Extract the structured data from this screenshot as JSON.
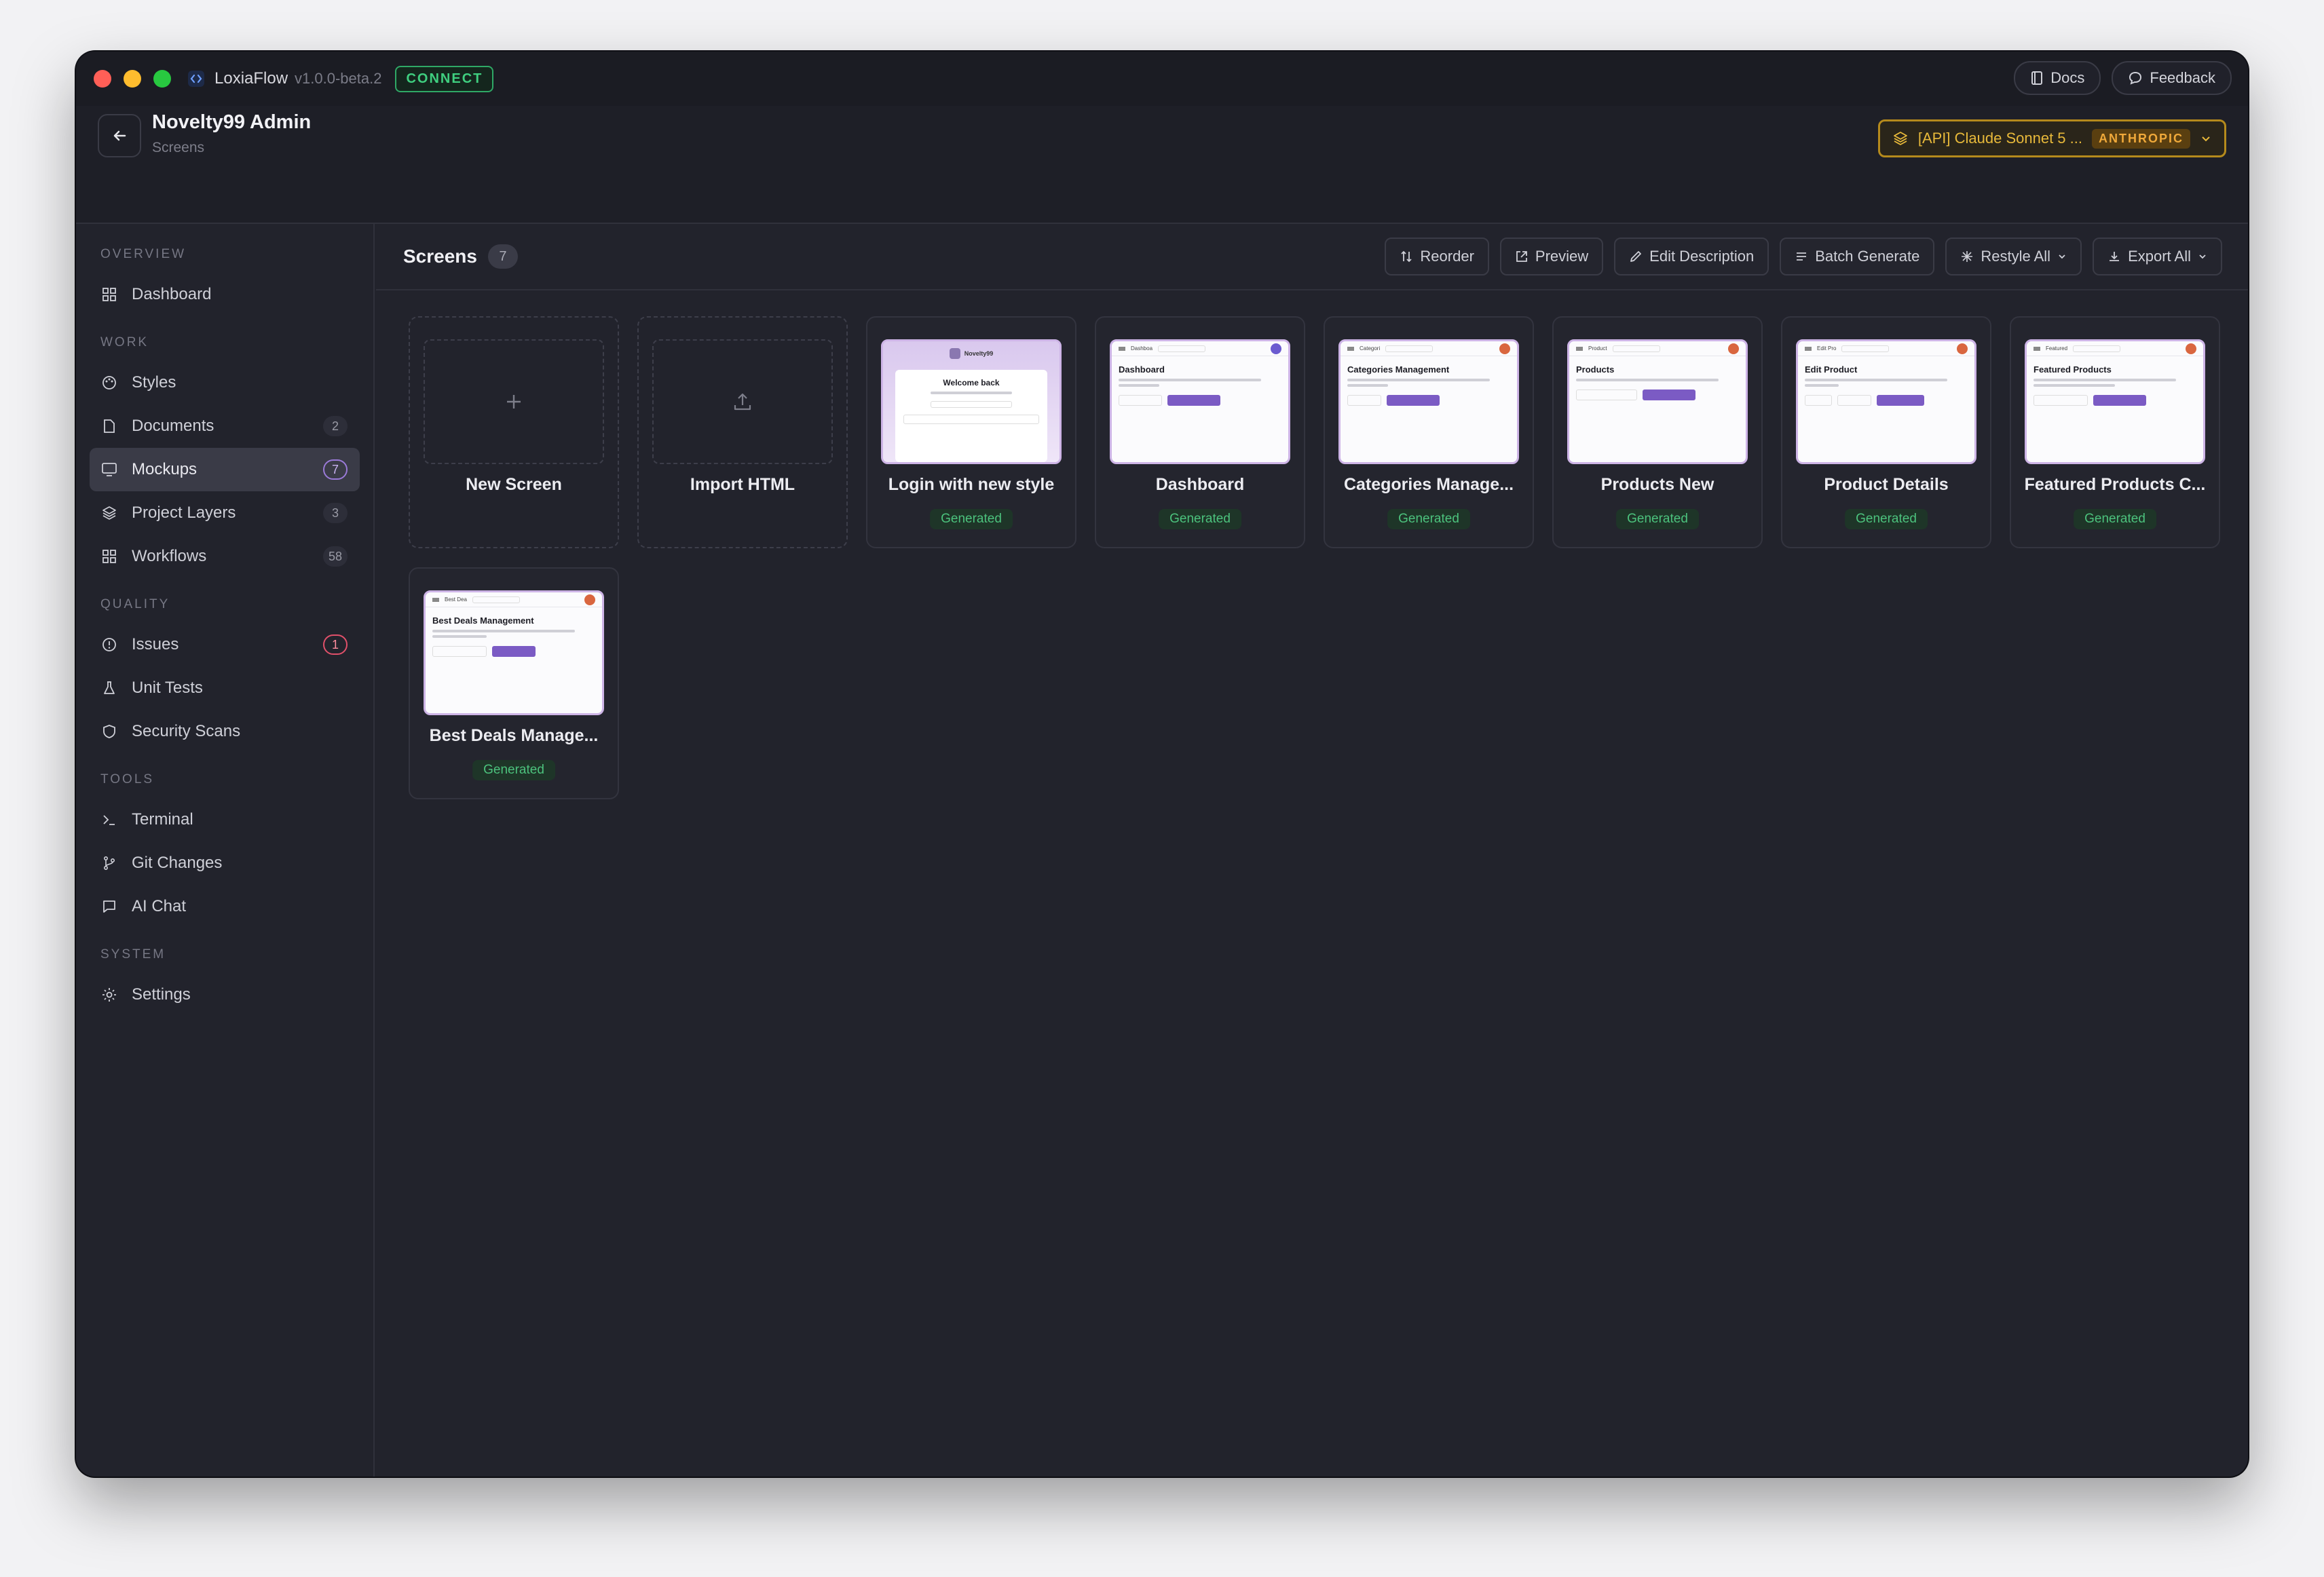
{
  "app": {
    "name": "LoxiaFlow",
    "version": "v1.0.0-beta.2",
    "connect_label": "CONNECT"
  },
  "titlebar": {
    "docs_label": "Docs",
    "feedback_label": "Feedback"
  },
  "project": {
    "name": "Novelty99 Admin",
    "subtitle": "Screens"
  },
  "model": {
    "label": "[API] Claude Sonnet 5 ...",
    "provider": "ANTHROPIC"
  },
  "sidebar": {
    "sections": [
      {
        "title": "OVERVIEW",
        "items": [
          {
            "label": "Dashboard",
            "icon": "grid-icon"
          }
        ]
      },
      {
        "title": "WORK",
        "items": [
          {
            "label": "Styles",
            "icon": "palette-icon"
          },
          {
            "label": "Documents",
            "icon": "document-icon",
            "badge": "2"
          },
          {
            "label": "Mockups",
            "icon": "monitor-icon",
            "badge": "7",
            "active": true
          },
          {
            "label": "Project Layers",
            "icon": "layers-icon",
            "badge": "3"
          },
          {
            "label": "Workflows",
            "icon": "grid-icon",
            "badge": "58"
          }
        ]
      },
      {
        "title": "QUALITY",
        "items": [
          {
            "label": "Issues",
            "icon": "alert-circle-icon",
            "badge": "1"
          },
          {
            "label": "Unit Tests",
            "icon": "flask-icon"
          },
          {
            "label": "Security Scans",
            "icon": "shield-icon"
          }
        ]
      },
      {
        "title": "TOOLS",
        "items": [
          {
            "label": "Terminal",
            "icon": "terminal-icon"
          },
          {
            "label": "Git Changes",
            "icon": "git-branch-icon"
          },
          {
            "label": "AI Chat",
            "icon": "chat-icon"
          }
        ]
      },
      {
        "title": "SYSTEM",
        "items": [
          {
            "label": "Settings",
            "icon": "gear-icon"
          }
        ]
      }
    ]
  },
  "toolbar": {
    "title": "Screens",
    "count": "7",
    "reorder": "Reorder",
    "preview": "Preview",
    "edit_description": "Edit Description",
    "batch_generate": "Batch Generate",
    "restyle_all": "Restyle All",
    "export_all": "Export All"
  },
  "cards": {
    "new_screen": "New Screen",
    "import_html": "Import HTML",
    "screens": [
      {
        "label": "Login with new style",
        "status": "Generated",
        "thumb_title": "Welcome back",
        "thumb_brand": "Novelty99"
      },
      {
        "label": "Dashboard",
        "status": "Generated",
        "thumb_title": "Dashboard",
        "thumb_tab": "Dashboa"
      },
      {
        "label": "Categories Manage...",
        "status": "Generated",
        "thumb_title": "Categories Management",
        "thumb_tab": "Categori"
      },
      {
        "label": "Products New",
        "status": "Generated",
        "thumb_title": "Products",
        "thumb_tab": "Product"
      },
      {
        "label": "Product Details",
        "status": "Generated",
        "thumb_title": "Edit Product",
        "thumb_tab": "Edit Pro"
      },
      {
        "label": "Featured Products C...",
        "status": "Generated",
        "thumb_title": "Featured Products",
        "thumb_tab": "Featured"
      },
      {
        "label": "Best Deals Manage...",
        "status": "Generated",
        "thumb_title": "Best Deals Management",
        "thumb_tab": "Best Dea"
      }
    ]
  },
  "colors": {
    "accent": "#7b5bc4",
    "connect": "#3fcf7f",
    "model_border": "#b58a1c",
    "generated": "#4cc27d"
  }
}
